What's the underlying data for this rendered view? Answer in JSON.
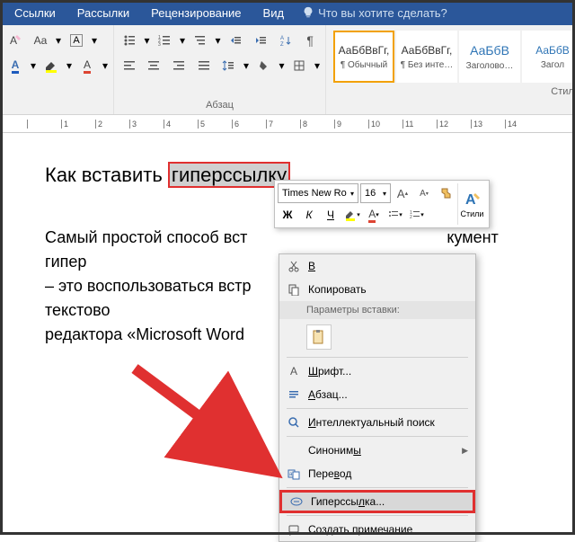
{
  "tabs": {
    "references": "Ссылки",
    "mailings": "Рассылки",
    "review": "Рецензирование",
    "view": "Вид",
    "tellme": "Что вы хотите сделать?"
  },
  "groups": {
    "paragraph": "Абзац",
    "styles": "Стили"
  },
  "style_sample": "АаБбВвГг,",
  "style_sample_blue": "АаБбВ",
  "style_names": {
    "normal": "¶ Обычный",
    "nospace": "¶ Без инте…",
    "heading1": "Заголово…",
    "heading2": "Загол"
  },
  "doc": {
    "title_before": "Как вставить ",
    "title_hl": "гиперссылку",
    "body_l1": "Самый простой способ вст",
    "body_l1_after": "кумент гипер",
    "body_l2": "– это воспользоваться встр",
    "body_l2_after": "ами текстово",
    "body_l3": "редактора «Microsoft Word"
  },
  "mini": {
    "font": "Times New Ro",
    "size": "16",
    "bold": "Ж",
    "italic": "К",
    "underline": "Ч",
    "styles": "Стили"
  },
  "ctx": {
    "cut": "Вырезать",
    "copy": "Копировать",
    "paste_header": "Параметры вставки:",
    "font": "Шрифт...",
    "paragraph": "Абзац...",
    "smart": "Интеллектуальный поиск",
    "synonyms": "Синонимы",
    "translate": "Перевод",
    "hyperlink": "Гиперссылка...",
    "comment": "Создать примечание"
  },
  "ruler": [
    " ",
    "1",
    "2",
    "3",
    "4",
    "5",
    "6",
    "7",
    "8",
    "9",
    "10",
    "11",
    "12",
    "13",
    "14"
  ]
}
